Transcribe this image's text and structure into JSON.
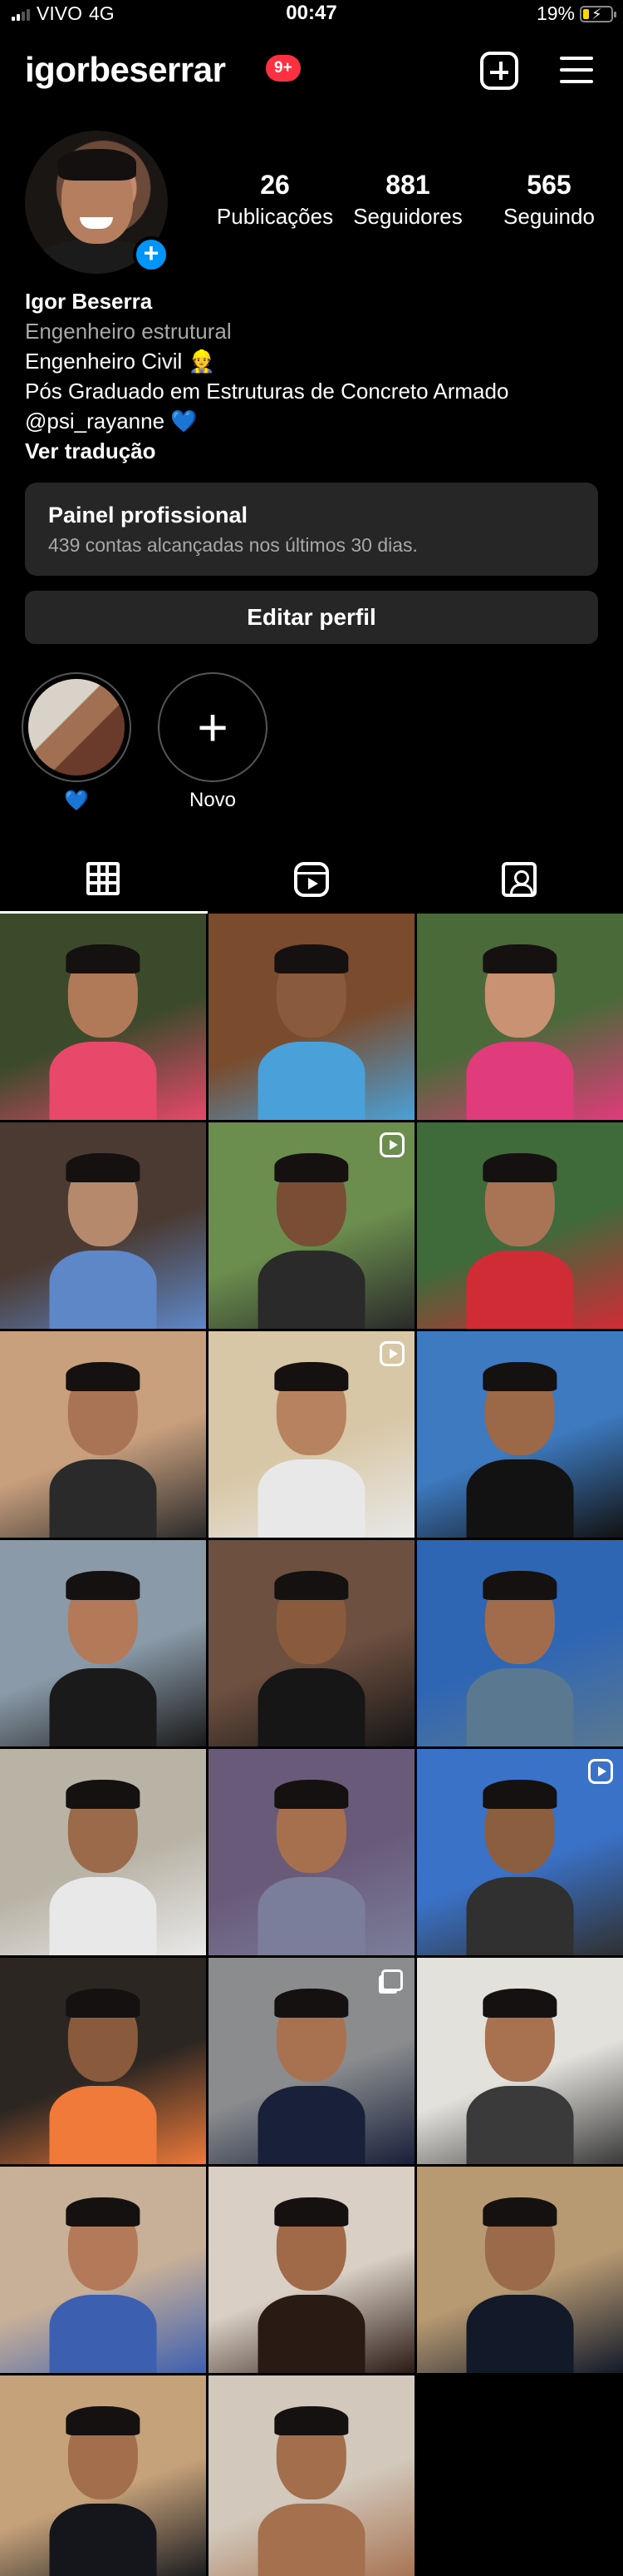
{
  "status": {
    "carrier": "VIVO",
    "network": "4G",
    "time": "00:47",
    "battery": "19%",
    "accent": "#ffd60a"
  },
  "header": {
    "username": "igorbeserrar",
    "notifications": "9+"
  },
  "stats": [
    {
      "value": "26",
      "label": "Publicações"
    },
    {
      "value": "881",
      "label": "Seguidores"
    },
    {
      "value": "565",
      "label": "Seguindo"
    }
  ],
  "bio": {
    "name": "Igor Beserra",
    "category": "Engenheiro estrutural",
    "line1": "Engenheiro Civil 👷",
    "line2": "Pós Graduado em Estruturas de Concreto Armado",
    "line3": "@psi_rayanne 💙",
    "translate": "Ver tradução"
  },
  "panel": {
    "title": "Painel profissional",
    "subtitle": "439 contas alcançadas nos últimos 30 dias."
  },
  "edit_profile": "Editar perfil",
  "highlights": [
    {
      "caption": "💙"
    },
    {
      "caption": "Novo"
    }
  ],
  "tabs": [
    "grid-icon",
    "reels-icon",
    "tagged-icon"
  ],
  "posts": [
    {
      "colors": [
        "#3a4a2a",
        "#e8486a"
      ],
      "skin": "#b07a58",
      "badge": ""
    },
    {
      "colors": [
        "#7a4b2c",
        "#4aa0d8"
      ],
      "skin": "#8a5a3d",
      "badge": ""
    },
    {
      "colors": [
        "#4a6a3a",
        "#e03b7a"
      ],
      "skin": "#c99272",
      "badge": ""
    },
    {
      "colors": [
        "#4a3a32",
        "#5e87c8"
      ],
      "skin": "#b58a6c",
      "badge": ""
    },
    {
      "colors": [
        "#6b8e4e",
        "#2a2a2a"
      ],
      "skin": "#7a4e34",
      "badge": "reel"
    },
    {
      "colors": [
        "#3f6a3a",
        "#d02c36"
      ],
      "skin": "#a97355",
      "badge": ""
    },
    {
      "colors": [
        "#c9a07e",
        "#2a2a2a"
      ],
      "skin": "#a97355",
      "badge": ""
    },
    {
      "colors": [
        "#d8c7a6",
        "#e8e8e8"
      ],
      "skin": "#b6825f",
      "badge": "reel"
    },
    {
      "colors": [
        "#3d7ac0",
        "#121212"
      ],
      "skin": "#9b6848",
      "badge": ""
    },
    {
      "colors": [
        "#8a9aa8",
        "#1a1a1a"
      ],
      "skin": "#b27a58",
      "badge": ""
    },
    {
      "colors": [
        "#6e5040",
        "#161616"
      ],
      "skin": "#8a5a3d",
      "badge": ""
    },
    {
      "colors": [
        "#2f66b4",
        "#5a7890"
      ],
      "skin": "#a06c4c",
      "badge": ""
    },
    {
      "colors": [
        "#b9b3a6",
        "#e8e8e8"
      ],
      "skin": "#9a6a4a",
      "badge": ""
    },
    {
      "colors": [
        "#6a5a7a",
        "#7a7e9a"
      ],
      "skin": "#a6704f",
      "badge": ""
    },
    {
      "colors": [
        "#3a72c8",
        "#303030"
      ],
      "skin": "#8c5e40",
      "badge": "reel"
    },
    {
      "colors": [
        "#2c2622",
        "#ef7a3a"
      ],
      "skin": "#8a5a3d",
      "badge": ""
    },
    {
      "colors": [
        "#8a8c8e",
        "#18203a"
      ],
      "skin": "#a87250",
      "badge": "multi"
    },
    {
      "colors": [
        "#e3e1dc",
        "#3a3a3a"
      ],
      "skin": "#a87250",
      "badge": ""
    },
    {
      "colors": [
        "#c8b098",
        "#3d5fb0"
      ],
      "skin": "#b27a58",
      "badge": ""
    },
    {
      "colors": [
        "#d9cfc4",
        "#2a1a14"
      ],
      "skin": "#a06a48",
      "badge": ""
    },
    {
      "colors": [
        "#b89a72",
        "#121a2a"
      ],
      "skin": "#9a6a4a",
      "badge": ""
    },
    {
      "colors": [
        "#c6a27a",
        "#14161c"
      ],
      "skin": "#a36e4c",
      "badge": ""
    },
    {
      "colors": [
        "#d2c9bc",
        "#a5704e"
      ],
      "skin": "#a36e4c",
      "badge": ""
    }
  ]
}
